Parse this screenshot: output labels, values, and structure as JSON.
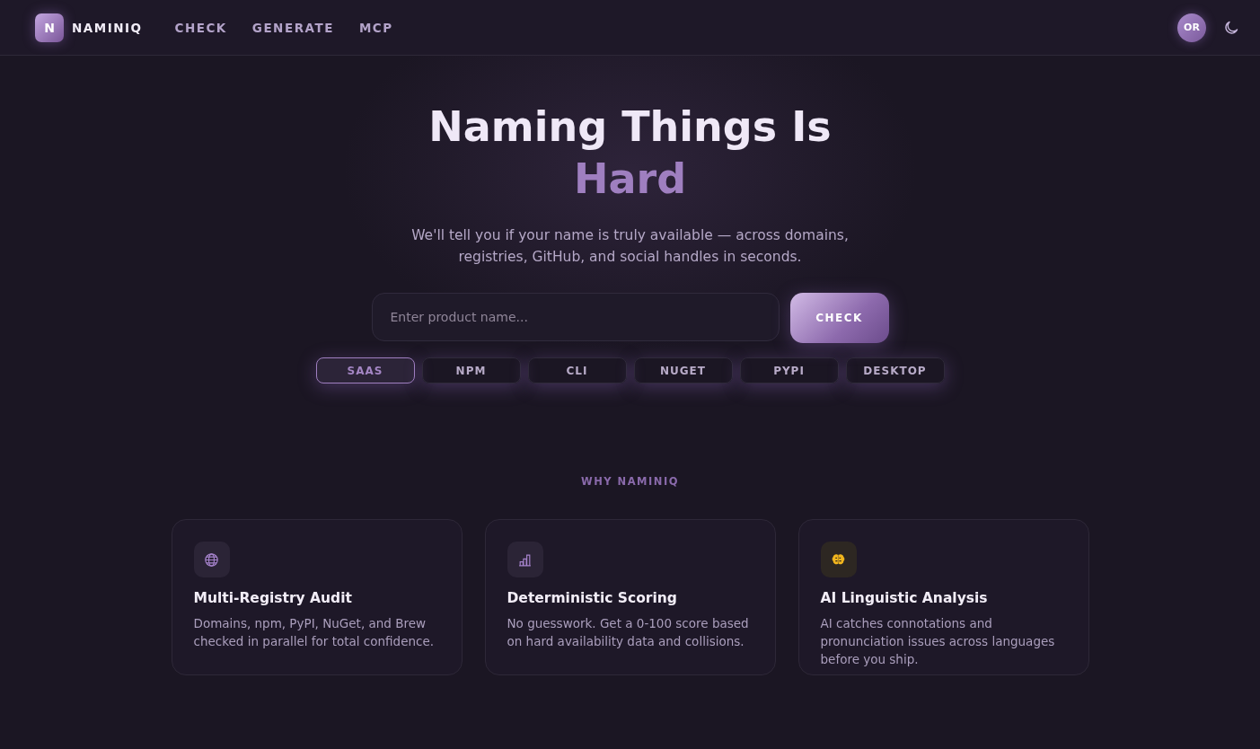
{
  "header": {
    "logo_letter": "N",
    "brand": "NAMINIQ",
    "nav": [
      {
        "label": "CHECK"
      },
      {
        "label": "GENERATE"
      },
      {
        "label": "MCP"
      }
    ],
    "avatar": "OR"
  },
  "hero": {
    "title": "Naming Things Is",
    "title_accent": "Hard",
    "subtitle": "We'll tell you if your name is truly available — across domains, registries, GitHub, and social handles in seconds.",
    "search": {
      "placeholder": "Enter product name..."
    },
    "button": "CHECK",
    "types": [
      {
        "label": "SAAS",
        "selected": true
      },
      {
        "label": "NPM",
        "selected": false
      },
      {
        "label": "CLI",
        "selected": false
      },
      {
        "label": "NUGET",
        "selected": false
      },
      {
        "label": "PYPI",
        "selected": false
      },
      {
        "label": "DESKTOP",
        "selected": false
      }
    ]
  },
  "features": {
    "eyebrow": "WHY NAMINIQ",
    "cards": [
      {
        "kind": "globe",
        "title": "Multi-Registry Audit",
        "text": "Domains, npm, PyPI, NuGet, and Brew checked in parallel for total confidence."
      },
      {
        "kind": "chart",
        "title": "Deterministic Scoring",
        "text": "No guesswork. Get a 0-100 score based on hard availability data and collisions."
      },
      {
        "kind": "brain",
        "title": "AI Linguistic Analysis",
        "text": "AI catches connotations and pronunciation issues across languages before you ship."
      }
    ]
  }
}
